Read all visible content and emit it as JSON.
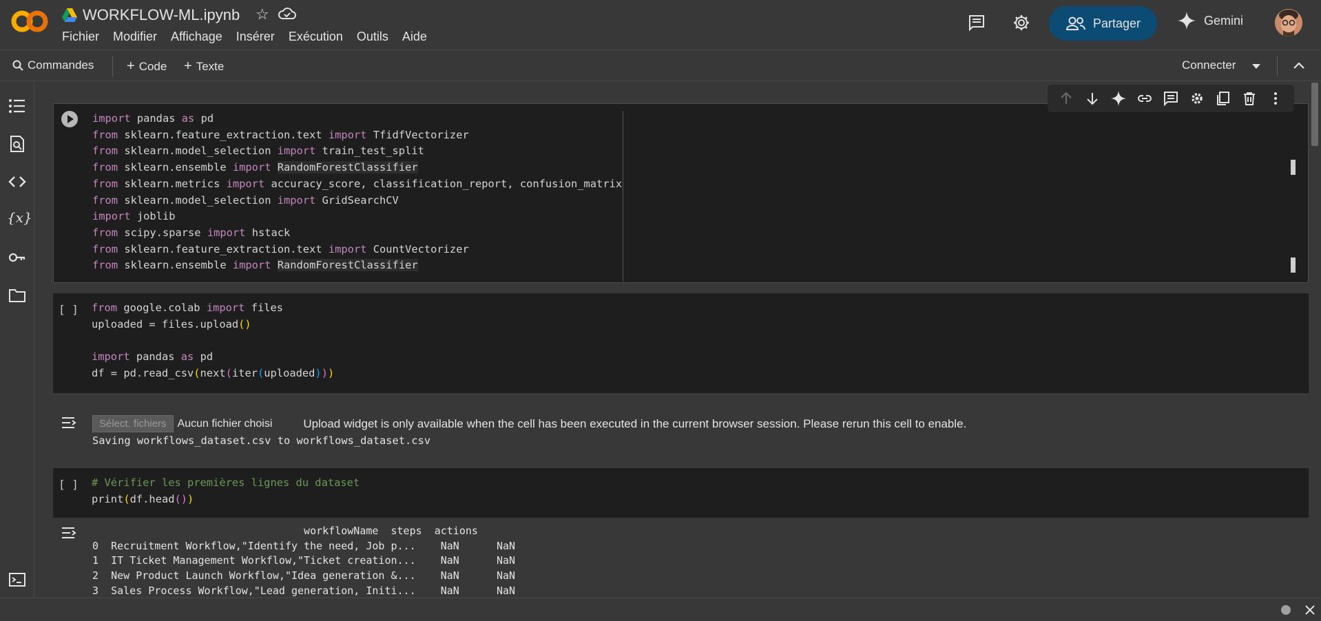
{
  "header": {
    "title": "WORKFLOW-ML.ipynb",
    "menu": [
      "Fichier",
      "Modifier",
      "Affichage",
      "Insérer",
      "Exécution",
      "Outils",
      "Aide"
    ],
    "share_label": "Partager",
    "gemini_label": "Gemini"
  },
  "toolbar": {
    "commands_label": "Commandes",
    "code_label": "Code",
    "text_label": "Texte",
    "connect_label": "Connecter"
  },
  "cells": {
    "cell1": {
      "lines": [
        "import pandas as pd",
        "from sklearn.feature_extraction.text import TfidfVectorizer",
        "from sklearn.model_selection import train_test_split",
        "from sklearn.ensemble import RandomForestClassifier",
        "from sklearn.metrics import accuracy_score, classification_report, confusion_matrix",
        "from sklearn.model_selection import GridSearchCV",
        "import joblib",
        "from scipy.sparse import hstack",
        "from sklearn.feature_extraction.text import CountVectorizer",
        "from sklearn.ensemble import RandomForestClassifier"
      ]
    },
    "cell2": {
      "bracket": "[ ]",
      "upload_button": "Sélect. fichiers",
      "no_file": "Aucun fichier choisi",
      "upload_warning": "Upload widget is only available when the cell has been executed in the current browser session. Please rerun this cell to enable.",
      "saving": "Saving workflows_dataset.csv to workflows_dataset.csv"
    },
    "cell3": {
      "bracket": "[ ]",
      "comment": "# Vérifier les premières lignes du dataset",
      "output_lines": [
        "                                  workflowName  steps  actions",
        "0  Recruitment Workflow,\"Identify the need, Job p...    NaN      NaN",
        "1  IT Ticket Management Workflow,\"Ticket creation...    NaN      NaN",
        "2  New Product Launch Workflow,\"Idea generation &...    NaN      NaN",
        "3  Sales Process Workflow,\"Lead generation, Initi...    NaN      NaN"
      ]
    }
  },
  "colors": {
    "keyword": "#c586c0",
    "comment": "#6a9955",
    "share_bg": "#0b4b74",
    "cell_bg": "#1e1e1e",
    "page_bg": "#383838"
  }
}
